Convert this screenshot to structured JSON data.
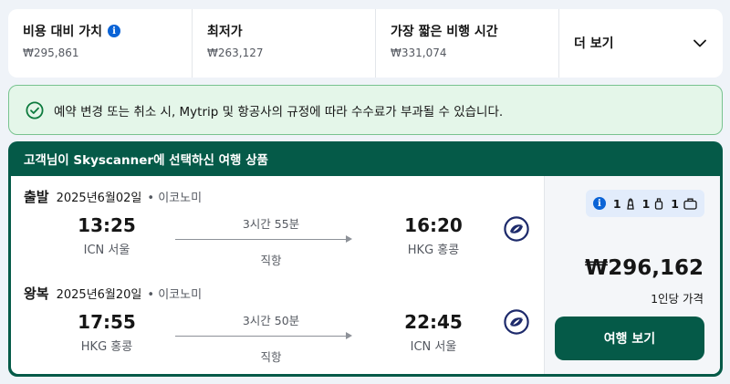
{
  "sort": {
    "best": {
      "label": "비용 대비 가치",
      "price": "₩295,861"
    },
    "cheapest": {
      "label": "최저가",
      "price": "₩263,127"
    },
    "fastest": {
      "label": "가장 짧은 비행 시간",
      "price": "₩331,074"
    },
    "more": {
      "label": "더 보기"
    }
  },
  "notice": {
    "text": "예약 변경 또는 취소 시, Mytrip 및 항공사의 규정에 따라 수수료가 부과될 수 있습니다."
  },
  "card": {
    "header": "고객님이 Skyscanner에 선택하신 여행 상품",
    "outbound": {
      "direction": "출발",
      "date": "2025년6월02일",
      "cabin": "• 이코노미",
      "depart_time": "13:25",
      "depart_airport": "ICN 서울",
      "duration": "3시간 55분",
      "stops": "직항",
      "arrive_time": "16:20",
      "arrive_airport": "HKG 홍콩"
    },
    "inbound": {
      "direction": "왕복",
      "date": "2025년6월20일",
      "cabin": "• 이코노미",
      "depart_time": "17:55",
      "depart_airport": "HKG 홍콩",
      "duration": "3시간 50분",
      "stops": "직항",
      "arrive_time": "22:45",
      "arrive_airport": "ICN 서울"
    },
    "baggage": {
      "personal_item": "1",
      "carry_on": "1",
      "checked": "1"
    },
    "price": "₩296,162",
    "price_note": "1인당 가격",
    "cta": "여행 보기"
  },
  "colors": {
    "brand_green": "#055a48",
    "info_blue": "#0a63d6",
    "notice_bg": "#e4f6e9",
    "airline_navy": "#1d2a6b"
  }
}
